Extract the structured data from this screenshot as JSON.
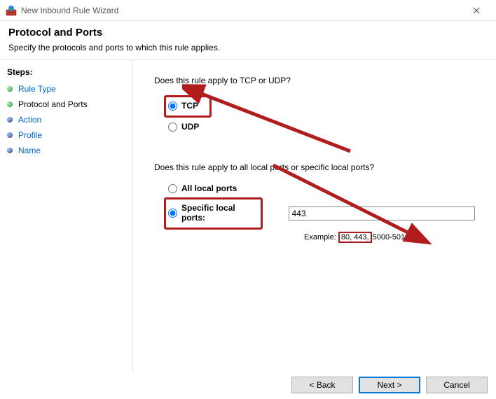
{
  "window": {
    "title": "New Inbound Rule Wizard"
  },
  "header": {
    "title": "Protocol and Ports",
    "subtitle": "Specify the protocols and ports to which this rule applies."
  },
  "sidebar": {
    "steps_label": "Steps:",
    "items": [
      {
        "label": "Rule Type",
        "active": false
      },
      {
        "label": "Protocol and Ports",
        "active": true
      },
      {
        "label": "Action",
        "active": false
      },
      {
        "label": "Profile",
        "active": false
      },
      {
        "label": "Name",
        "active": false
      }
    ]
  },
  "main": {
    "q1": "Does this rule apply to TCP or UDP?",
    "tcp_label": "TCP",
    "udp_label": "UDP",
    "protocol_selected": "tcp",
    "q2": "Does this rule apply to all local ports or specific local ports?",
    "all_ports_label": "All local ports",
    "specific_ports_label": "Specific local ports:",
    "ports_selected": "specific",
    "ports_value": "443",
    "example_prefix": "Example:",
    "example_highlight": "80, 443,",
    "example_suffix": "5000-5010"
  },
  "footer": {
    "back": "< Back",
    "next": "Next >",
    "cancel": "Cancel"
  }
}
